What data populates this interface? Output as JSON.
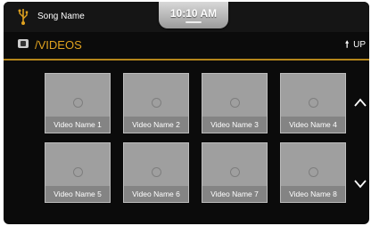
{
  "status": {
    "song_name": "Song Name",
    "time": "10:10 AM"
  },
  "path": {
    "label": "/VIDEOS",
    "up_label": "UP"
  },
  "videos": [
    {
      "name": "Video Name 1"
    },
    {
      "name": "Video Name 2"
    },
    {
      "name": "Video Name 3"
    },
    {
      "name": "Video Name 4"
    },
    {
      "name": "Video Name 5"
    },
    {
      "name": "Video Name 6"
    },
    {
      "name": "Video Name 7"
    },
    {
      "name": "Video Name 8"
    }
  ],
  "icons": {
    "usb": "usb-icon",
    "folder": "folder-icon",
    "up": "up-arrow-icon",
    "scroll_up": "chevron-up-icon",
    "scroll_down": "chevron-down-icon"
  },
  "colors": {
    "accent": "#e0a21f",
    "divider": "#b5861a",
    "background": "#0b0b0b",
    "tile": "#9f9f9f"
  }
}
